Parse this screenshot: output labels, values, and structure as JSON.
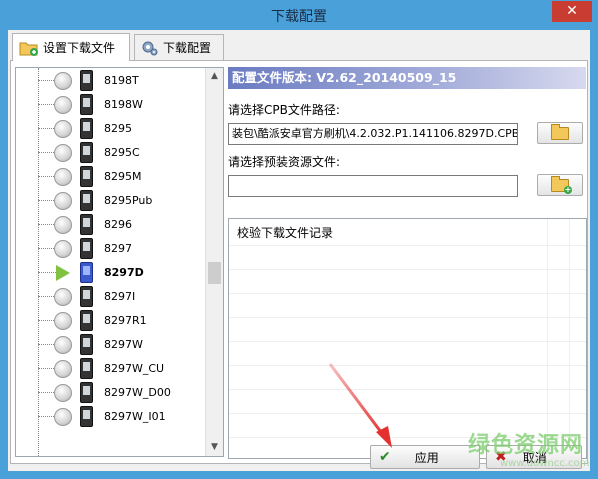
{
  "window": {
    "title": "下载配置",
    "close_symbol": "✕"
  },
  "tabs": [
    {
      "label": "设置下载文件",
      "active": true,
      "icon": "folder-add-icon"
    },
    {
      "label": "下载配置",
      "active": false,
      "icon": "gear-icon"
    }
  ],
  "tree": {
    "items": [
      {
        "label": "8198T",
        "selected": false
      },
      {
        "label": "8198W",
        "selected": false
      },
      {
        "label": "8295",
        "selected": false
      },
      {
        "label": "8295C",
        "selected": false
      },
      {
        "label": "8295M",
        "selected": false
      },
      {
        "label": "8295Pub",
        "selected": false
      },
      {
        "label": "8296",
        "selected": false
      },
      {
        "label": "8297",
        "selected": false
      },
      {
        "label": "8297D",
        "selected": true
      },
      {
        "label": "8297I",
        "selected": false
      },
      {
        "label": "8297R1",
        "selected": false
      },
      {
        "label": "8297W",
        "selected": false
      },
      {
        "label": "8297W_CU",
        "selected": false
      },
      {
        "label": "8297W_D00",
        "selected": false
      },
      {
        "label": "8297W_I01",
        "selected": false
      }
    ],
    "scroll_up_symbol": "▲",
    "scroll_down_symbol": "▼"
  },
  "config": {
    "version_text": "配置文件版本: V2.62_20140509_15",
    "cpb_label": "请选择CPB文件路径:",
    "cpb_value": "装包\\酷派安卓官方刷机\\4.2.032.P1.141106.8297D.CPB",
    "resource_label": "请选择预装资源文件:",
    "resource_value": "",
    "log_title": "校验下载文件记录"
  },
  "buttons": {
    "apply_label": "应用",
    "cancel_label": "取消",
    "check_symbol": "✔",
    "cancel_symbol": "✖"
  },
  "watermark": {
    "main": "绿色资源网",
    "sub": "www.downcc.com"
  },
  "colors": {
    "title_bar": "#4aa0d8",
    "close_button": "#c83c31",
    "version_bar": "#6a7bc1",
    "arrow": "#e53030",
    "selected_arrow": "#7fc242"
  }
}
